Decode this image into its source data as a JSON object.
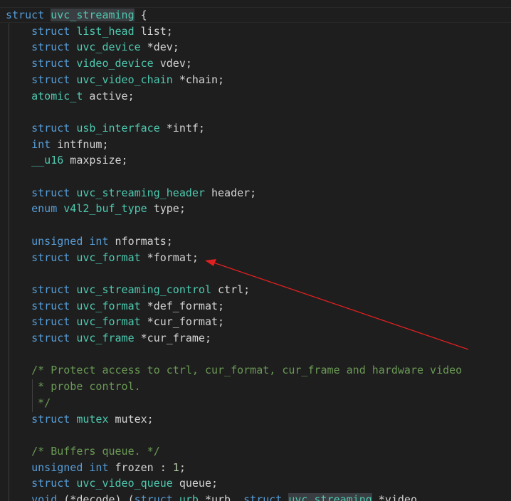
{
  "editor": {
    "lines": [
      {
        "tokens": [
          {
            "t": "struct",
            "c": "kw"
          },
          {
            "t": " ",
            "c": "punct"
          },
          {
            "t": "uvc_streaming",
            "c": "hl-type"
          },
          {
            "t": " {",
            "c": "punct"
          }
        ]
      },
      {
        "tokens": [
          {
            "t": "    ",
            "c": "punct"
          },
          {
            "t": "struct",
            "c": "kw"
          },
          {
            "t": " ",
            "c": "punct"
          },
          {
            "t": "list_head",
            "c": "type"
          },
          {
            "t": " list;",
            "c": "ident"
          }
        ]
      },
      {
        "tokens": [
          {
            "t": "    ",
            "c": "punct"
          },
          {
            "t": "struct",
            "c": "kw"
          },
          {
            "t": " ",
            "c": "punct"
          },
          {
            "t": "uvc_device",
            "c": "type"
          },
          {
            "t": " *dev;",
            "c": "ident"
          }
        ]
      },
      {
        "tokens": [
          {
            "t": "    ",
            "c": "punct"
          },
          {
            "t": "struct",
            "c": "kw"
          },
          {
            "t": " ",
            "c": "punct"
          },
          {
            "t": "video_device",
            "c": "type"
          },
          {
            "t": " vdev;",
            "c": "ident"
          }
        ]
      },
      {
        "tokens": [
          {
            "t": "    ",
            "c": "punct"
          },
          {
            "t": "struct",
            "c": "kw"
          },
          {
            "t": " ",
            "c": "punct"
          },
          {
            "t": "uvc_video_chain",
            "c": "type"
          },
          {
            "t": " *chain;",
            "c": "ident"
          }
        ]
      },
      {
        "tokens": [
          {
            "t": "    ",
            "c": "punct"
          },
          {
            "t": "atomic_t",
            "c": "type"
          },
          {
            "t": " active;",
            "c": "ident"
          }
        ]
      },
      {
        "tokens": []
      },
      {
        "tokens": [
          {
            "t": "    ",
            "c": "punct"
          },
          {
            "t": "struct",
            "c": "kw"
          },
          {
            "t": " ",
            "c": "punct"
          },
          {
            "t": "usb_interface",
            "c": "type"
          },
          {
            "t": " *intf;",
            "c": "ident"
          }
        ]
      },
      {
        "tokens": [
          {
            "t": "    ",
            "c": "punct"
          },
          {
            "t": "int",
            "c": "kw"
          },
          {
            "t": " intfnum;",
            "c": "ident"
          }
        ]
      },
      {
        "tokens": [
          {
            "t": "    ",
            "c": "punct"
          },
          {
            "t": "__u16",
            "c": "type"
          },
          {
            "t": " maxpsize;",
            "c": "ident"
          }
        ]
      },
      {
        "tokens": []
      },
      {
        "tokens": [
          {
            "t": "    ",
            "c": "punct"
          },
          {
            "t": "struct",
            "c": "kw"
          },
          {
            "t": " ",
            "c": "punct"
          },
          {
            "t": "uvc_streaming_header",
            "c": "type"
          },
          {
            "t": " header;",
            "c": "ident"
          }
        ]
      },
      {
        "tokens": [
          {
            "t": "    ",
            "c": "punct"
          },
          {
            "t": "enum",
            "c": "kw"
          },
          {
            "t": " ",
            "c": "punct"
          },
          {
            "t": "v4l2_buf_type",
            "c": "type"
          },
          {
            "t": " type;",
            "c": "ident"
          }
        ]
      },
      {
        "tokens": []
      },
      {
        "tokens": [
          {
            "t": "    ",
            "c": "punct"
          },
          {
            "t": "unsigned",
            "c": "kw"
          },
          {
            "t": " ",
            "c": "punct"
          },
          {
            "t": "int",
            "c": "kw"
          },
          {
            "t": " nformats;",
            "c": "ident"
          }
        ]
      },
      {
        "tokens": [
          {
            "t": "    ",
            "c": "punct"
          },
          {
            "t": "struct",
            "c": "kw"
          },
          {
            "t": " ",
            "c": "punct"
          },
          {
            "t": "uvc_format",
            "c": "type"
          },
          {
            "t": " *format;",
            "c": "ident"
          }
        ]
      },
      {
        "tokens": []
      },
      {
        "tokens": [
          {
            "t": "    ",
            "c": "punct"
          },
          {
            "t": "struct",
            "c": "kw"
          },
          {
            "t": " ",
            "c": "punct"
          },
          {
            "t": "uvc_streaming_control",
            "c": "type"
          },
          {
            "t": " ctrl;",
            "c": "ident"
          }
        ]
      },
      {
        "tokens": [
          {
            "t": "    ",
            "c": "punct"
          },
          {
            "t": "struct",
            "c": "kw"
          },
          {
            "t": " ",
            "c": "punct"
          },
          {
            "t": "uvc_format",
            "c": "type"
          },
          {
            "t": " *def_format;",
            "c": "ident"
          }
        ]
      },
      {
        "tokens": [
          {
            "t": "    ",
            "c": "punct"
          },
          {
            "t": "struct",
            "c": "kw"
          },
          {
            "t": " ",
            "c": "punct"
          },
          {
            "t": "uvc_format",
            "c": "type"
          },
          {
            "t": " *cur_format;",
            "c": "ident"
          }
        ]
      },
      {
        "tokens": [
          {
            "t": "    ",
            "c": "punct"
          },
          {
            "t": "struct",
            "c": "kw"
          },
          {
            "t": " ",
            "c": "punct"
          },
          {
            "t": "uvc_frame",
            "c": "type"
          },
          {
            "t": " *cur_frame;",
            "c": "ident"
          }
        ]
      },
      {
        "tokens": []
      },
      {
        "tokens": [
          {
            "t": "    ",
            "c": "punct"
          },
          {
            "t": "/* Protect access to ctrl, cur_format, cur_frame and hardware video",
            "c": "comment"
          }
        ]
      },
      {
        "tokens": [
          {
            "t": "     * probe control.",
            "c": "comment"
          }
        ]
      },
      {
        "tokens": [
          {
            "t": "     */",
            "c": "comment"
          }
        ]
      },
      {
        "tokens": [
          {
            "t": "    ",
            "c": "punct"
          },
          {
            "t": "struct",
            "c": "kw"
          },
          {
            "t": " ",
            "c": "punct"
          },
          {
            "t": "mutex",
            "c": "type"
          },
          {
            "t": " mutex;",
            "c": "ident"
          }
        ]
      },
      {
        "tokens": []
      },
      {
        "tokens": [
          {
            "t": "    ",
            "c": "punct"
          },
          {
            "t": "/* Buffers queue. */",
            "c": "comment"
          }
        ]
      },
      {
        "tokens": [
          {
            "t": "    ",
            "c": "punct"
          },
          {
            "t": "unsigned",
            "c": "kw"
          },
          {
            "t": " ",
            "c": "punct"
          },
          {
            "t": "int",
            "c": "kw"
          },
          {
            "t": " frozen : ",
            "c": "ident"
          },
          {
            "t": "1",
            "c": "num"
          },
          {
            "t": ";",
            "c": "punct"
          }
        ]
      },
      {
        "tokens": [
          {
            "t": "    ",
            "c": "punct"
          },
          {
            "t": "struct",
            "c": "kw"
          },
          {
            "t": " ",
            "c": "punct"
          },
          {
            "t": "uvc_video_queue",
            "c": "type"
          },
          {
            "t": " queue;",
            "c": "ident"
          }
        ]
      },
      {
        "tokens": [
          {
            "t": "    ",
            "c": "punct"
          },
          {
            "t": "void",
            "c": "kw"
          },
          {
            "t": " (*decode) (",
            "c": "ident"
          },
          {
            "t": "struct",
            "c": "kw"
          },
          {
            "t": " ",
            "c": "punct"
          },
          {
            "t": "urb",
            "c": "type"
          },
          {
            "t": " *urb, ",
            "c": "ident"
          },
          {
            "t": "struct",
            "c": "kw"
          },
          {
            "t": " ",
            "c": "punct"
          },
          {
            "t": "uvc_streaming",
            "c": "hl-type"
          },
          {
            "t": " *video,",
            "c": "ident"
          }
        ]
      }
    ]
  },
  "colors": {
    "background": "#1e1e1e",
    "keyword": "#569cd6",
    "type": "#4ec9b0",
    "identifier": "#d4d4d4",
    "comment": "#6a9955",
    "number": "#b5cea8",
    "annotation_arrow": "#e02020"
  }
}
